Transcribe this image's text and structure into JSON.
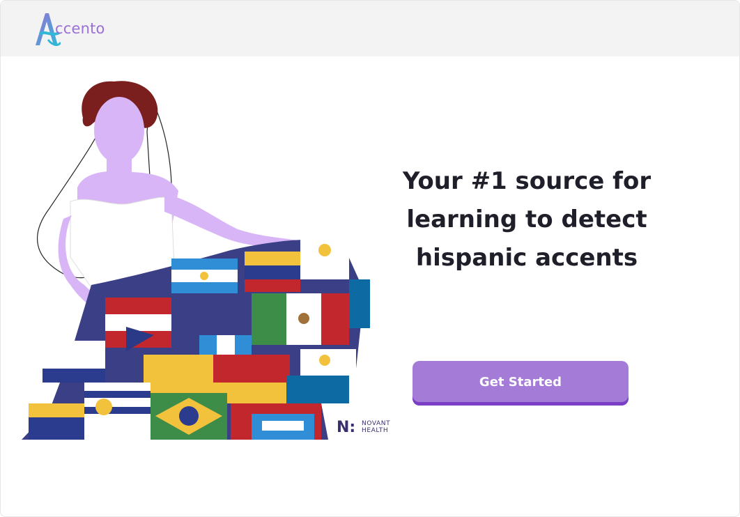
{
  "header": {
    "logo_text": "ccento",
    "logo_letter": "A",
    "logo_icon": "accento-logo-icon"
  },
  "hero": {
    "headline": "Your #1 source for learning to detect hispanic accents",
    "cta_label": "Get Started",
    "illustration": "woman-in-flag-dress-illustration"
  },
  "partner": {
    "mark": "N:",
    "name_line1": "NOVANT",
    "name_line2": "HEALTH"
  },
  "colors": {
    "accent": "#a57bd8",
    "accent_dark": "#7a3fc5",
    "header_bg": "#f3f3f3",
    "text": "#1f1f2a"
  }
}
